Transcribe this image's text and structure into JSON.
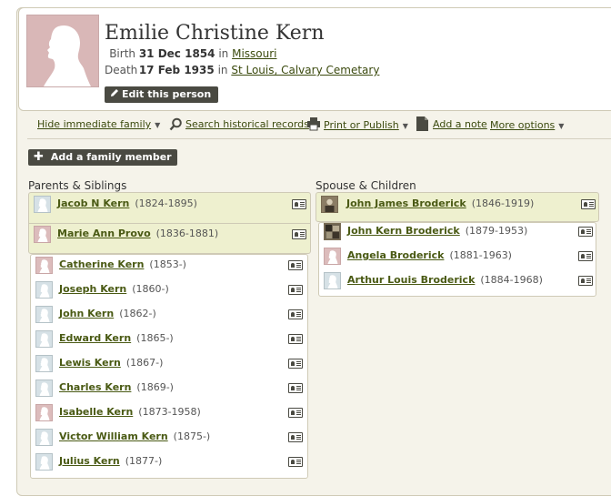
{
  "person": {
    "name": "Emilie Christine Kern",
    "birth": {
      "label": "Birth",
      "date": "31 Dec 1854",
      "in": "in",
      "place": "Missouri"
    },
    "death": {
      "label": "Death",
      "date": "17 Feb 1935",
      "in": "in",
      "place": "St Louis, Calvary Cemetary"
    },
    "edit_label": "Edit this person"
  },
  "toolbar": {
    "hide_family": "Hide immediate family",
    "search_records": "Search historical records",
    "print_publish": "Print or Publish",
    "add_note": "Add a note",
    "more_options": "More options"
  },
  "add_member_label": "Add a family member",
  "parents_siblings": {
    "title": "Parents & Siblings",
    "parents": [
      {
        "name": "Jacob N Kern",
        "dates": "(1824-1895)",
        "gender": "m"
      },
      {
        "name": "Marie Ann Provo",
        "dates": "(1836-1881)",
        "gender": "f"
      }
    ],
    "siblings": [
      {
        "name": "Catherine Kern",
        "dates": "(1853-)",
        "gender": "f"
      },
      {
        "name": "Joseph Kern",
        "dates": "(1860-)",
        "gender": "m"
      },
      {
        "name": "John Kern",
        "dates": "(1862-)",
        "gender": "m"
      },
      {
        "name": "Edward Kern",
        "dates": "(1865-)",
        "gender": "m"
      },
      {
        "name": "Lewis Kern",
        "dates": "(1867-)",
        "gender": "m"
      },
      {
        "name": "Charles Kern",
        "dates": "(1869-)",
        "gender": "m"
      },
      {
        "name": "Isabelle Kern",
        "dates": "(1873-1958)",
        "gender": "f"
      },
      {
        "name": "Victor William Kern",
        "dates": "(1875-)",
        "gender": "m"
      },
      {
        "name": "Julius Kern",
        "dates": "(1877-)",
        "gender": "m"
      }
    ]
  },
  "spouse_children": {
    "title": "Spouse & Children",
    "spouse": {
      "name": "John James Broderick",
      "dates": "(1846-1919)",
      "gender": "photo"
    },
    "children": [
      {
        "name": "John Kern Broderick",
        "dates": "(1879-1953)",
        "gender": "photo"
      },
      {
        "name": "Angela Broderick",
        "dates": "(1881-1963)",
        "gender": "f"
      },
      {
        "name": "Arthur Louis Broderick",
        "dates": "(1884-1968)",
        "gender": "m"
      }
    ]
  },
  "icons": {
    "search": "magnifier-icon",
    "print": "printer-icon",
    "note": "note-icon",
    "card": "profile-card-icon",
    "edit": "pencil-icon",
    "add": "plus-icon"
  }
}
